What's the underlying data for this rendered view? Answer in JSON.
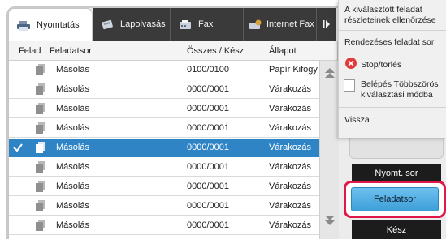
{
  "tabs": [
    {
      "label": "Nyomtatás",
      "icon": "printer-icon",
      "active": true
    },
    {
      "label": "Lapolvasás",
      "icon": "scanner-icon",
      "active": false
    },
    {
      "label": "Fax",
      "icon": "fax-icon",
      "active": false
    },
    {
      "label": "Internet Fax",
      "icon": "internet-fax-icon",
      "active": false
    }
  ],
  "more_tabs_icon": "chevron-right-icon",
  "columns": {
    "job": "Felad",
    "queue": "Feladatsor",
    "total": "Összes / Kész",
    "status": "Állapot"
  },
  "rows": [
    {
      "name": "Másolás",
      "count": "0100/0100",
      "status": "Papír Kifogy",
      "selected": false
    },
    {
      "name": "Másolás",
      "count": "0000/0001",
      "status": "Várakozás",
      "selected": false
    },
    {
      "name": "Másolás",
      "count": "0000/0001",
      "status": "Várakozás",
      "selected": false
    },
    {
      "name": "Másolás",
      "count": "0000/0001",
      "status": "Várakozás",
      "selected": false
    },
    {
      "name": "Másolás",
      "count": "0000/0001",
      "status": "Várakozás",
      "selected": true
    },
    {
      "name": "Másolás",
      "count": "0000/0001",
      "status": "Várakozás",
      "selected": false
    },
    {
      "name": "Másolás",
      "count": "0000/0001",
      "status": "Várakozás",
      "selected": false
    },
    {
      "name": "Másolás",
      "count": "0000/0001",
      "status": "Várakozás",
      "selected": false
    },
    {
      "name": "Másolás",
      "count": "0000/0001",
      "status": "Várakozás",
      "selected": false
    }
  ],
  "menu": {
    "check_details": "A kiválasztott feladat részleteinek ellenőrzése",
    "priority_job": "Rendezéses feladat sor",
    "stop_delete": "Stop/törlés",
    "multi_select": "Belépés Többszörös kiválasztási módba",
    "back": "Vissza"
  },
  "buttons": {
    "print_queue": "Nyomt. sor",
    "job_queue": "Feladatsor",
    "done": "Kész"
  },
  "colors": {
    "selected_row": "#2f84c6",
    "tab_bar": "#3a3a3a",
    "highlight_border": "#e0184a",
    "active_button": "#4aa6dd",
    "stop_icon": "#e23a3a"
  }
}
